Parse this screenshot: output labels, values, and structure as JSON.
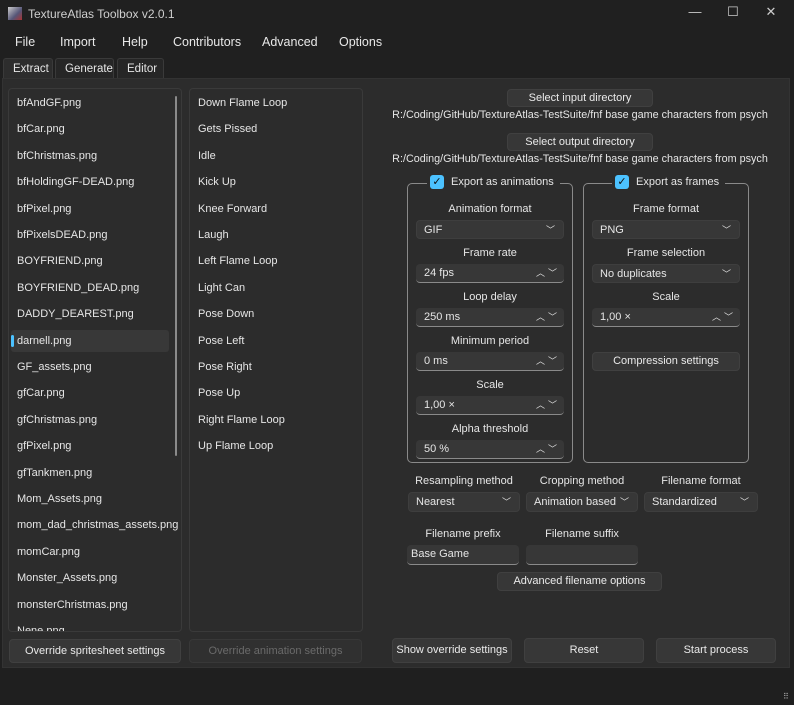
{
  "window": {
    "title": "TextureAtlas Toolbox v2.0.1"
  },
  "menu": [
    "File",
    "Import",
    "Help",
    "Contributors",
    "Advanced",
    "Options"
  ],
  "tabs": [
    "Extract",
    "Generate",
    "Editor"
  ],
  "spritesheets": [
    "bfAndGF.png",
    "bfCar.png",
    "bfChristmas.png",
    "bfHoldingGF-DEAD.png",
    "bfPixel.png",
    "bfPixelsDEAD.png",
    "BOYFRIEND.png",
    "BOYFRIEND_DEAD.png",
    "DADDY_DEAREST.png",
    "darnell.png",
    "GF_assets.png",
    "gfCar.png",
    "gfChristmas.png",
    "gfPixel.png",
    "gfTankmen.png",
    "Mom_Assets.png",
    "mom_dad_christmas_assets.png",
    "momCar.png",
    "Monster_Assets.png",
    "monsterChristmas.png",
    "Nene.png"
  ],
  "selected_spritesheet": "darnell.png",
  "animations": [
    "Down Flame Loop",
    "Gets Pissed",
    "Idle",
    "Kick Up",
    "Knee Forward",
    "Laugh",
    "Left Flame Loop",
    "Light Can",
    "Pose Down",
    "Pose Left",
    "Pose Right",
    "Pose Up",
    "Right Flame Loop",
    "Up Flame Loop"
  ],
  "buttons": {
    "override_spritesheet": "Override spritesheet settings",
    "override_animation": "Override animation settings",
    "select_input": "Select input directory",
    "select_output": "Select output directory",
    "compression": "Compression settings",
    "advanced_filename": "Advanced filename options",
    "show_override": "Show override settings",
    "reset": "Reset",
    "start": "Start process"
  },
  "paths": {
    "input": "R:/Coding/GitHub/TextureAtlas-TestSuite/fnf base game characters from psych",
    "output": "R:/Coding/GitHub/TextureAtlas-TestSuite/fnf base game characters from psych"
  },
  "animations_group": {
    "label": "Export as animations",
    "checked": true,
    "animation_format_label": "Animation format",
    "animation_format": "GIF",
    "frame_rate_label": "Frame rate",
    "frame_rate": "24 fps",
    "loop_delay_label": "Loop delay",
    "loop_delay": "250 ms",
    "min_period_label": "Minimum period",
    "min_period": "0 ms",
    "scale_label": "Scale",
    "scale": "1,00 ×",
    "alpha_label": "Alpha threshold",
    "alpha": "50 %"
  },
  "frames_group": {
    "label": "Export as frames",
    "checked": true,
    "frame_format_label": "Frame format",
    "frame_format": "PNG",
    "frame_selection_label": "Frame selection",
    "frame_selection": "No duplicates",
    "scale_label": "Scale",
    "scale": "1,00 ×"
  },
  "options": {
    "resampling_label": "Resampling method",
    "resampling": "Nearest",
    "cropping_label": "Cropping method",
    "cropping": "Animation based",
    "filename_format_label": "Filename format",
    "filename_format": "Standardized",
    "prefix_label": "Filename prefix",
    "prefix": "Base Game",
    "suffix_label": "Filename suffix",
    "suffix": ""
  },
  "colors": {
    "accent": "#4cc2ff",
    "background": "#2c2c2c"
  }
}
